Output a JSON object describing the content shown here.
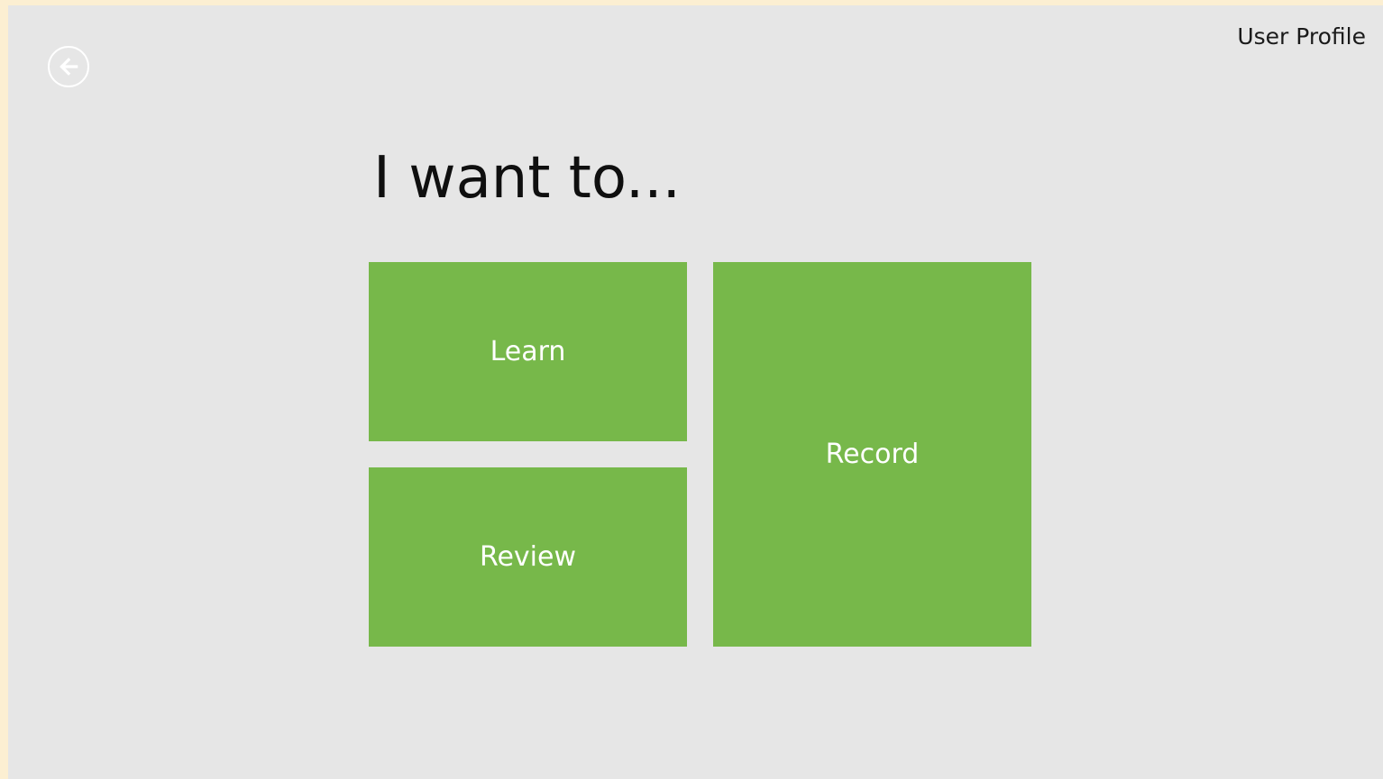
{
  "header": {
    "back_icon": "arrow-left-circle-icon",
    "user_profile_label": "User Profile"
  },
  "main": {
    "heading": "I want to...",
    "tiles": [
      {
        "label": "Learn"
      },
      {
        "label": "Review"
      },
      {
        "label": "Record"
      }
    ]
  },
  "colors": {
    "tile": "#77b84a",
    "background": "#e6e6e6",
    "border": "#fcefd2"
  }
}
